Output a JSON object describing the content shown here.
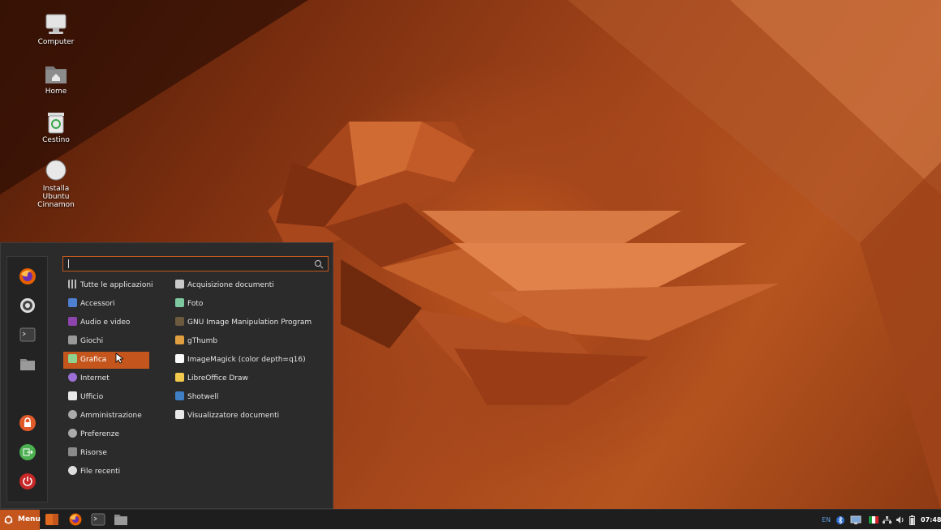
{
  "desktop": {
    "icons": [
      {
        "label": "Computer",
        "icon": "computer-icon"
      },
      {
        "label": "Home",
        "icon": "home-folder-icon"
      },
      {
        "label": "Cestino",
        "icon": "trash-icon"
      },
      {
        "label": "Installa Ubuntu Cinnamon",
        "icon": "installer-icon"
      }
    ]
  },
  "menu": {
    "search": {
      "value": "",
      "placeholder": ""
    },
    "favorites": [
      {
        "name": "firefox",
        "icon": "firefox-icon"
      },
      {
        "name": "settings",
        "icon": "settings-icon"
      },
      {
        "name": "terminal",
        "icon": "terminal-icon"
      },
      {
        "name": "files",
        "icon": "folder-icon"
      }
    ],
    "session": [
      {
        "name": "lock",
        "icon": "lock-icon"
      },
      {
        "name": "logout",
        "icon": "logout-icon"
      },
      {
        "name": "shutdown",
        "icon": "power-icon"
      }
    ],
    "categories": [
      {
        "label": "Tutte le applicazioni",
        "icon": "grid-icon"
      },
      {
        "label": "Accessori",
        "icon": "accessories-icon"
      },
      {
        "label": "Audio e video",
        "icon": "multimedia-icon"
      },
      {
        "label": "Giochi",
        "icon": "games-icon"
      },
      {
        "label": "Grafica",
        "icon": "graphics-icon",
        "active": true
      },
      {
        "label": "Internet",
        "icon": "internet-icon"
      },
      {
        "label": "Ufficio",
        "icon": "office-icon"
      },
      {
        "label": "Amministrazione",
        "icon": "administration-icon"
      },
      {
        "label": "Preferenze",
        "icon": "preferences-icon"
      },
      {
        "label": "Risorse",
        "icon": "places-icon"
      },
      {
        "label": "File recenti",
        "icon": "recent-icon"
      }
    ],
    "apps": [
      {
        "label": "Acquisizione documenti",
        "icon": "scanner-icon"
      },
      {
        "label": "Foto",
        "icon": "photos-icon"
      },
      {
        "label": "GNU Image Manipulation Program",
        "icon": "gimp-icon"
      },
      {
        "label": "gThumb",
        "icon": "gthumb-icon"
      },
      {
        "label": "ImageMagick (color depth=q16)",
        "icon": "imagemagick-icon"
      },
      {
        "label": "LibreOffice Draw",
        "icon": "libreoffice-draw-icon"
      },
      {
        "label": "Shotwell",
        "icon": "shotwell-icon"
      },
      {
        "label": "Visualizzatore documenti",
        "icon": "document-viewer-icon"
      }
    ]
  },
  "taskbar": {
    "menu_label": "Menu",
    "launchers": [
      "show-desktop-icon",
      "firefox-icon",
      "terminal-icon",
      "folder-icon"
    ],
    "keyboard_layout": "EN",
    "clock": "07:48"
  },
  "colors": {
    "accent": "#c4561d",
    "panel": "#2b2b2b",
    "taskbar": "#1e1e1e"
  }
}
